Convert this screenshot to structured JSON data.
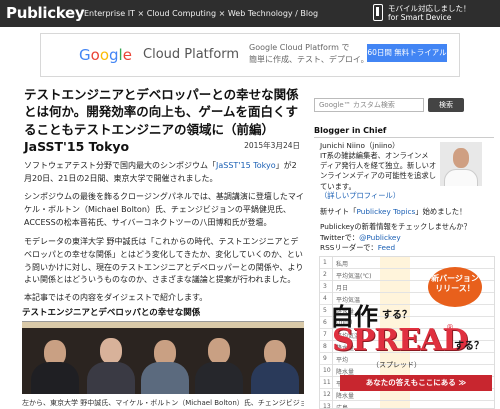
{
  "header": {
    "logo": "Publickey",
    "tagline": "Enterprise IT × Cloud Computing × Web Technology / Blog",
    "mobile_line1": "モバイル対応しました！",
    "mobile_line2": "for Smart Device"
  },
  "google_ad": {
    "brand_letters": [
      "G",
      "o",
      "o",
      "g",
      "l",
      "e"
    ],
    "brand_colors": [
      "#4285f4",
      "#ea4335",
      "#fbbc05",
      "#4285f4",
      "#34a853",
      "#ea4335"
    ],
    "product": "Cloud Platform",
    "text1": "Google Cloud Platform で",
    "text2": "簡単に作成、テスト、デプロイ。",
    "button": "60日間 無料トライアル"
  },
  "article": {
    "title": "テストエンジニアとデベロッパーとの幸せな関係とは何か。開発効率の向上も、ゲームを面白くすることもテストエンジニアの領域に（前編） JaSST'15 Tokyo",
    "date": "2015年3月24日",
    "p1_before": "ソフトウェアテスト分野で国内最大のシンポジウム「",
    "p1_link": "JaSST'15 Tokyo",
    "p1_after": "」が2月20日、21日の2日間、東京大学で開催されました。",
    "p2": "シンポジウムの最後を飾るクロージングパネルでは、基調講演に登壇したマイケル・ボルトン（Michael Bolton）氏、チェンジビジョンの平鍋健児氏、ACCESSの松本晋祐氏、サイバーコネクトツーの八田博和氏が登壇。",
    "p3": "モデレータの東洋大学 野中誠氏は「これからの時代、テストエンジニアとデベロッパとの幸せな関係」とはどう変化してきたか、変化していくのか、という問いかけに対し、現在のテストエンジニアとデベロッパーとの関係や、よりよい関係とはどういうものなのか、さまざまな議論と提案が行われました。",
    "p4": "本記事ではその内容をダイジェストで紹介します。",
    "section_heading": "テストエンジニアとデベロッパとの幸せな関係",
    "photo_caption": "左から、東京大学 野中誠氏、マイケル・ボルトン（Michael Bolton）氏、チェンジビジョン 平"
  },
  "sidebar": {
    "search_placeholder": "Google™ カスタム検索",
    "search_button": "検索",
    "blogger_heading": "Blogger in Chief",
    "author_name": "Junichi Niino（jniino）",
    "author_desc1": "IT系の雑誌編集者、オンラインメ",
    "author_desc2": "ディア発行人を経て独立。新しいオ",
    "author_desc3": "ンラインメディアの可能性を追求しています。",
    "profile_link": "（詳しいプロフィール）",
    "new_site_before": "新サイト「",
    "new_site_link": "Publickey Topics",
    "new_site_after": "」始めました！",
    "newsletter": "Publickeyの新着情報をチェックしませんか？",
    "twitter_label": "Twitterで：",
    "twitter_link": "@Publickey",
    "rss_label": "RSSリーダーで：",
    "rss_link": "Feed"
  },
  "spread_ad": {
    "badge": "新バージョン リリース！",
    "q1": "自作",
    "q1_suffix": "する？",
    "word": "SPREAD",
    "reg": "®",
    "q2": "する？",
    "kana": "（スプレッド）",
    "cta": "あなたの答えもここにある ≫",
    "sheet_labels": [
      "私用",
      "平均気温(℃)",
      "月日",
      "平均気温",
      "降水量",
      "(mm)",
      "平均気温",
      "降水量",
      "平均",
      "降水量",
      "平均気温",
      "降水量",
      "広島"
    ]
  }
}
